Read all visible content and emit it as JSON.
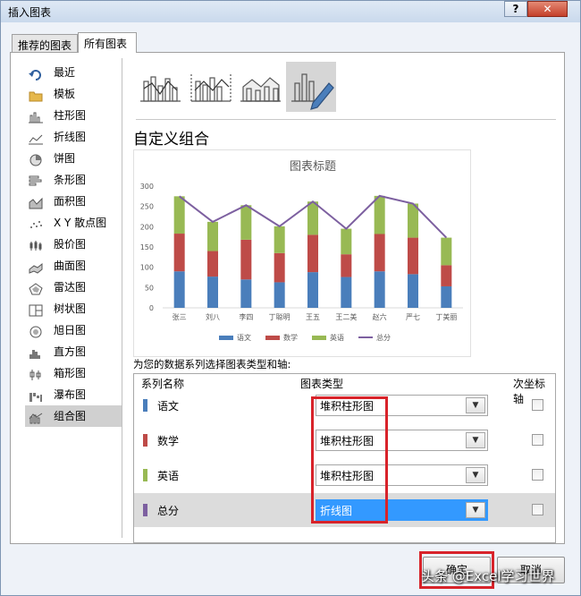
{
  "window": {
    "title": "插入图表",
    "help_label": "?",
    "close_label": "✕"
  },
  "tabs": [
    {
      "label": "推荐的图表"
    },
    {
      "label": "所有图表"
    }
  ],
  "sidebar": {
    "items": [
      {
        "label": "最近",
        "icon": "recent-icon"
      },
      {
        "label": "模板",
        "icon": "folder-icon"
      },
      {
        "label": "柱形图",
        "icon": "column-chart-icon"
      },
      {
        "label": "折线图",
        "icon": "line-chart-icon"
      },
      {
        "label": "饼图",
        "icon": "pie-chart-icon"
      },
      {
        "label": "条形图",
        "icon": "bar-chart-icon"
      },
      {
        "label": "面积图",
        "icon": "area-chart-icon"
      },
      {
        "label": "X Y 散点图",
        "icon": "scatter-chart-icon"
      },
      {
        "label": "股价图",
        "icon": "stock-chart-icon"
      },
      {
        "label": "曲面图",
        "icon": "surface-chart-icon"
      },
      {
        "label": "雷达图",
        "icon": "radar-chart-icon"
      },
      {
        "label": "树状图",
        "icon": "treemap-chart-icon"
      },
      {
        "label": "旭日图",
        "icon": "sunburst-chart-icon"
      },
      {
        "label": "直方图",
        "icon": "histogram-chart-icon"
      },
      {
        "label": "箱形图",
        "icon": "box-chart-icon"
      },
      {
        "label": "瀑布图",
        "icon": "waterfall-chart-icon"
      },
      {
        "label": "组合图",
        "icon": "combo-chart-icon"
      }
    ],
    "selected": "组合图"
  },
  "subtypes": [
    {
      "icon": "combo-column-line-icon"
    },
    {
      "icon": "combo-column-line-secondary-icon"
    },
    {
      "icon": "combo-area-column-icon"
    },
    {
      "icon": "custom-combo-icon"
    }
  ],
  "custom_title": "自定义组合",
  "axis_hint": "为您的数据系列选择图表类型和轴:",
  "table": {
    "col_series": "系列名称",
    "col_type": "图表类型",
    "col_secondary": "次坐标轴",
    "rows": [
      {
        "name": "语文",
        "type": "堆积柱形图",
        "color": "#4a7ebb",
        "secondary": false
      },
      {
        "name": "数学",
        "type": "堆积柱形图",
        "color": "#be4b48",
        "secondary": false
      },
      {
        "name": "英语",
        "type": "堆积柱形图",
        "color": "#98b954",
        "secondary": false
      },
      {
        "name": "总分",
        "type": "折线图",
        "color": "#7d60a0",
        "secondary": false
      }
    ]
  },
  "buttons": {
    "ok": "确定",
    "cancel": "取消"
  },
  "watermark": "头条 @Excel学习世界",
  "chart_data": {
    "type": "bar",
    "title": "图表标题",
    "categories": [
      "张三",
      "刘八",
      "李四",
      "丁聪明",
      "王五",
      "王二美",
      "赵六",
      "严七",
      "丁美丽"
    ],
    "ylim": [
      0,
      300
    ],
    "yticks": [
      0,
      50,
      100,
      150,
      200,
      250,
      300
    ],
    "stacked": true,
    "series": [
      {
        "name": "语文",
        "type": "bar",
        "color": "#4a7ebb",
        "values": [
          90,
          77,
          70,
          63,
          88,
          76,
          90,
          83,
          53
        ]
      },
      {
        "name": "数学",
        "type": "bar",
        "color": "#be4b48",
        "values": [
          93,
          63,
          98,
          72,
          92,
          56,
          92,
          90,
          52
        ]
      },
      {
        "name": "英语",
        "type": "bar",
        "color": "#98b954",
        "values": [
          92,
          72,
          85,
          66,
          82,
          63,
          94,
          84,
          68
        ]
      },
      {
        "name": "总分",
        "type": "line",
        "color": "#7d60a0",
        "values": [
          275,
          212,
          253,
          201,
          262,
          195,
          276,
          257,
          173
        ]
      }
    ],
    "grid": false,
    "legend": "bottom"
  }
}
